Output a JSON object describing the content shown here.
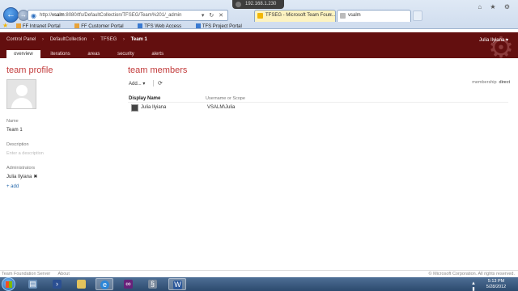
{
  "browser": {
    "address_url_pre": "http://",
    "address_url_host": "vsalm",
    "address_url_rest": ":8080/tfs/DefaultCollection/TFSEG/Team%201/_admin",
    "remote_ip": "192.168.1.230",
    "tabs": [
      {
        "label": "TFSEG - Microsoft Team Foun..."
      },
      {
        "label": "vsalm"
      }
    ],
    "favorites": [
      "FF Intranet Portal",
      "FF Customer Portal",
      "TFS Web Access",
      "TFS Project Portal"
    ]
  },
  "header": {
    "breadcrumbs": [
      "Control Panel",
      "DefaultCollection",
      "TFSEG",
      "Team 1"
    ],
    "user": "Julia Ilyiana",
    "nav_tabs": [
      "overview",
      "iterations",
      "areas",
      "security",
      "alerts"
    ],
    "active_tab": "overview"
  },
  "profile": {
    "heading": "team profile",
    "name_label": "Name",
    "name_value": "Team 1",
    "description_label": "Description",
    "description_placeholder": "Enter a description",
    "administrators_label": "Administrators",
    "administrator": "Julia Ilyiana",
    "remove_glyph": "✖",
    "add_link": "+ add"
  },
  "members": {
    "heading": "team members",
    "add_menu": "Add...",
    "membership_label": "membership",
    "membership_value": "direct",
    "columns": [
      "Display Name",
      "Username or Scope"
    ],
    "rows": [
      {
        "display_name": "Julia Ilyiana",
        "username": "VSALM\\Julia"
      }
    ]
  },
  "footer": {
    "left": [
      "Team Foundation Server",
      "About"
    ],
    "right": "© Microsoft Corporation. All rights reserved."
  },
  "taskbar": {
    "time": "5:13 PM",
    "date": "5/28/2012"
  }
}
